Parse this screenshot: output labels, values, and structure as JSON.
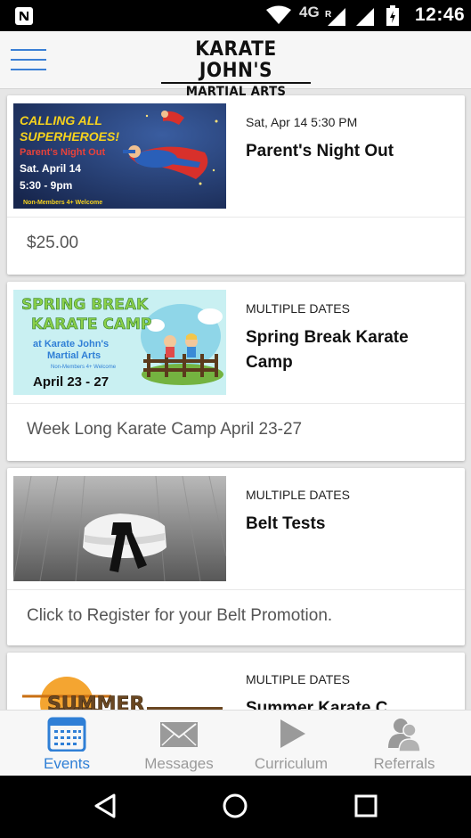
{
  "status_bar": {
    "network": "4G",
    "roaming": "R",
    "time": "12:46"
  },
  "header": {
    "logo_line1": "KARATE JOHN'S",
    "logo_line2": "MARTIAL ARTS CENTER"
  },
  "events": [
    {
      "date": "Sat, Apr 14 5:30 PM",
      "title": "Parent's Night Out",
      "description": "$25.00",
      "image": {
        "line1": "CALLING ALL",
        "line2": "SUPERHEROES!",
        "line3": "Parent's Night Out",
        "line4": "Sat. April 14",
        "line5": "5:30 - 9pm",
        "line6": "Non-Members 4+ Welcome"
      }
    },
    {
      "date": "MULTIPLE DATES",
      "title": "Spring Break Karate Camp",
      "description": "Week Long Karate Camp April 23-27",
      "image": {
        "line1": "SPRING BREAK",
        "line2": "KARATE CAMP",
        "line3": "at Karate John's",
        "line4": "Martial Arts",
        "line5": "Non-Members 4+ Welcome",
        "line6": "April 23 - 27"
      }
    },
    {
      "date": "MULTIPLE DATES",
      "title": "Belt Tests",
      "description": "Click to Register for your Belt Promotion."
    },
    {
      "date": "MULTIPLE DATES",
      "title": "Summer Karate C",
      "image": {
        "line1": "SUMMER"
      }
    }
  ],
  "tabs": [
    {
      "label": "Events",
      "icon": "calendar-icon",
      "active": true
    },
    {
      "label": "Messages",
      "icon": "envelope-icon",
      "active": false
    },
    {
      "label": "Curriculum",
      "icon": "play-icon",
      "active": false
    },
    {
      "label": "Referrals",
      "icon": "people-icon",
      "active": false
    }
  ],
  "colors": {
    "accent": "#2f7fd6",
    "inactive_tab": "#9a9a9a",
    "status_bar": "#000000"
  }
}
